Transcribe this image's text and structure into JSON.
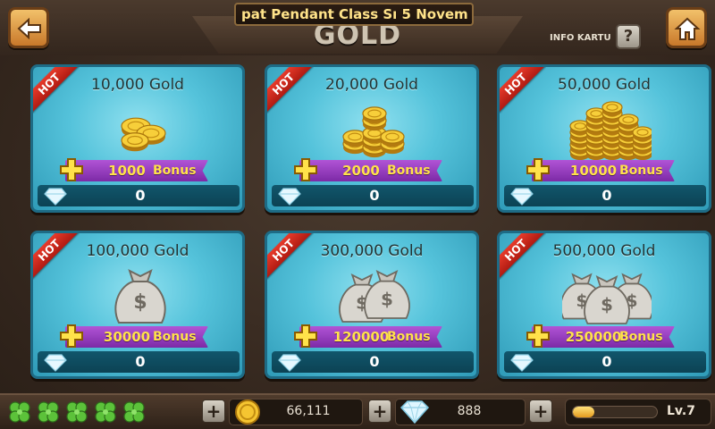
{
  "header": {
    "title": "GOLD",
    "ticker": "pat Pendant Class Sı 5 Novem",
    "info_label": "INFO KARTU",
    "info_button": "?"
  },
  "cards": [
    {
      "title": "10,000 Gold",
      "hot": "HOT",
      "bonus": "1000",
      "bonus_word": "Bonus",
      "price": "0",
      "art": "small-coin-pile-icon"
    },
    {
      "title": "20,000 Gold",
      "hot": "HOT",
      "bonus": "2000",
      "bonus_word": "Bonus",
      "price": "0",
      "art": "coin-stack-icon"
    },
    {
      "title": "50,000 Gold",
      "hot": "HOT",
      "bonus": "10000",
      "bonus_word": "Bonus",
      "price": "0",
      "art": "large-coin-stack-icon"
    },
    {
      "title": "100,000 Gold",
      "hot": "HOT",
      "bonus": "30000",
      "bonus_word": "Bonus",
      "price": "0",
      "art": "money-bag-icon"
    },
    {
      "title": "300,000 Gold",
      "hot": "HOT",
      "bonus": "120000",
      "bonus_word": "Bonus",
      "price": "0",
      "art": "two-money-bags-icon"
    },
    {
      "title": "500,000 Gold",
      "hot": "HOT",
      "bonus": "250000",
      "bonus_word": "Bonus",
      "price": "0",
      "art": "three-money-bags-icon"
    }
  ],
  "footer": {
    "clovers": 5,
    "plus": "+",
    "gold": "66,111",
    "gems": "888",
    "level": "Lv.7",
    "xp_fraction": 0.25
  },
  "colors": {
    "card": "#55c3db",
    "hot": "#d42a1c",
    "bonus": "#9a3fc4",
    "bonus_text": "#ffe24a"
  }
}
